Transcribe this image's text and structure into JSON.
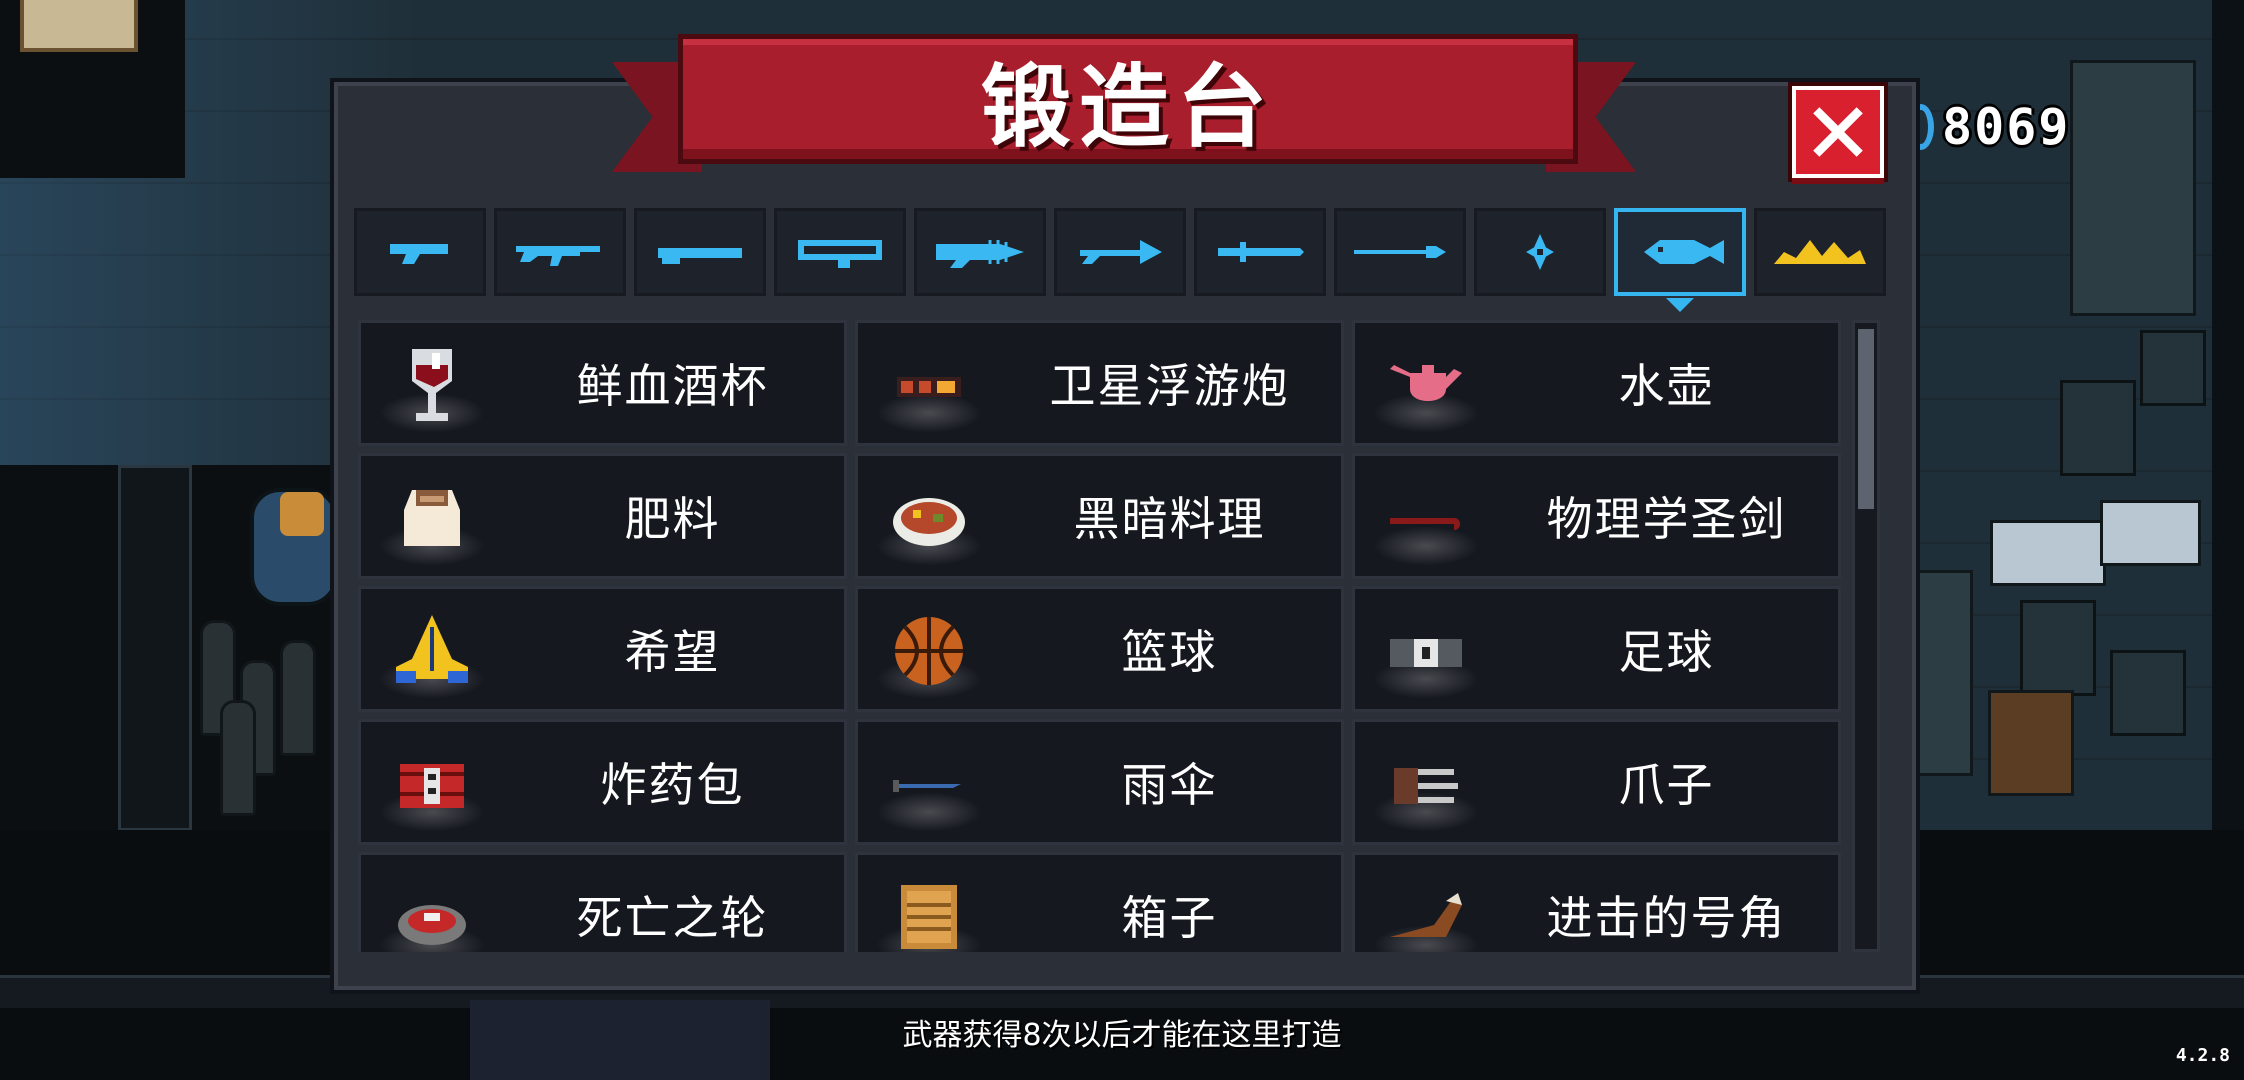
{
  "title": "锻造台",
  "coins": "8069",
  "hint": "武器获得8次以后才能在这里打造",
  "version": "4.2.8",
  "colors": {
    "accent": "#35b6f0",
    "banner": "#a81e2c",
    "close": "#d8202e"
  },
  "tabs": [
    {
      "icon": "pistol-icon",
      "selected": false
    },
    {
      "icon": "rifle-icon",
      "selected": false
    },
    {
      "icon": "shotgun-icon",
      "selected": false
    },
    {
      "icon": "launcher-icon",
      "selected": false
    },
    {
      "icon": "laser-gun-icon",
      "selected": false
    },
    {
      "icon": "bow-icon",
      "selected": false
    },
    {
      "icon": "sword-icon",
      "selected": false
    },
    {
      "icon": "spear-icon",
      "selected": false
    },
    {
      "icon": "shuriken-icon",
      "selected": false
    },
    {
      "icon": "fish-icon",
      "selected": true
    },
    {
      "icon": "crown-icon",
      "selected": false
    }
  ],
  "items": [
    {
      "label": "鲜血酒杯",
      "icon": "wine-glass-icon"
    },
    {
      "label": "卫星浮游炮",
      "icon": "satellite-cannon-icon"
    },
    {
      "label": "水壶",
      "icon": "teapot-icon"
    },
    {
      "label": "肥料",
      "icon": "fertilizer-bag-icon"
    },
    {
      "label": "黑暗料理",
      "icon": "dark-dish-icon"
    },
    {
      "label": "物理学圣剑",
      "icon": "crowbar-icon"
    },
    {
      "label": "希望",
      "icon": "praying-hands-icon"
    },
    {
      "label": "篮球",
      "icon": "basketball-icon"
    },
    {
      "label": "足球",
      "icon": "soccer-icon"
    },
    {
      "label": "炸药包",
      "icon": "dynamite-icon"
    },
    {
      "label": "雨伞",
      "icon": "umbrella-icon"
    },
    {
      "label": "爪子",
      "icon": "claw-icon"
    },
    {
      "label": "死亡之轮",
      "icon": "death-wheel-icon"
    },
    {
      "label": "箱子",
      "icon": "crate-icon"
    },
    {
      "label": "进击的号角",
      "icon": "horn-icon"
    }
  ]
}
